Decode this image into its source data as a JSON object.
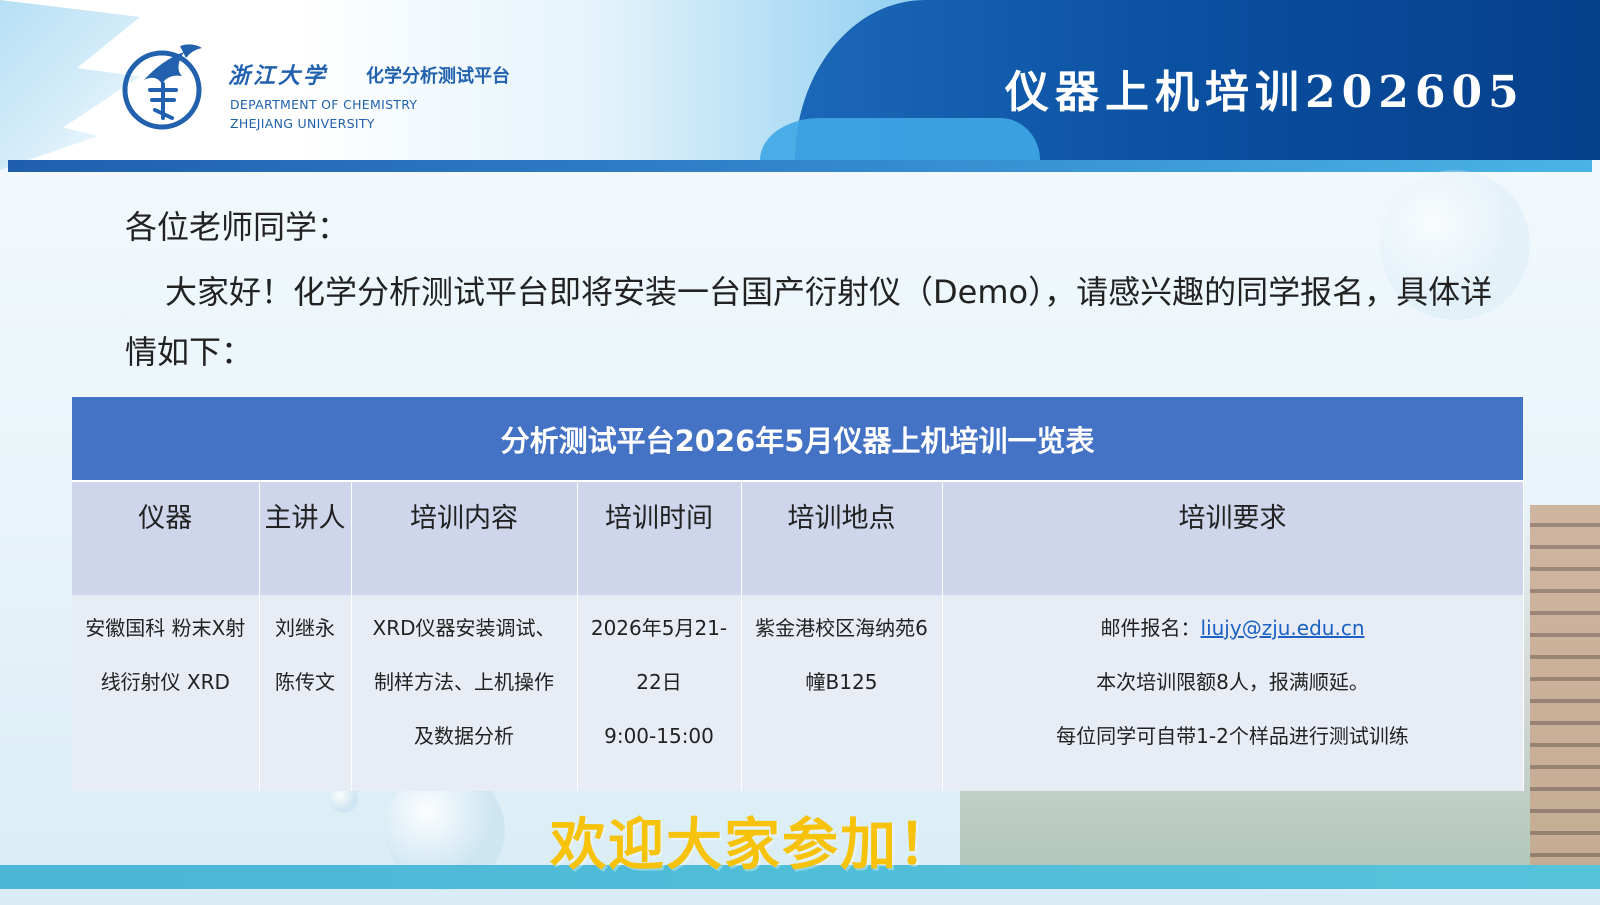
{
  "header": {
    "univ_cn": "浙江大学",
    "platform_cn": "化学分析测试平台",
    "dept_en": "DEPARTMENT OF CHEMISTRY",
    "univ_en": "ZHEJIANG UNIVERSITY",
    "banner_title": "仪器上机培训202605"
  },
  "body": {
    "greeting": "各位老师同学：",
    "intro": "大家好！化学分析测试平台即将安装一台国产衍射仪（Demo），请感兴趣的同学报名，具体详情如下："
  },
  "table": {
    "caption": "分析测试平台2026年5月仪器上机培训一览表",
    "headers": [
      "仪器",
      "主讲人",
      "培训内容",
      "培训时间",
      "培训地点",
      "培训要求"
    ],
    "row": {
      "instrument": [
        "安徽国科 粉末X射",
        "线衍射仪 XRD"
      ],
      "lecturers": [
        "刘继永",
        "陈传文"
      ],
      "content": [
        "XRD仪器安装调试、",
        "制样方法、上机操作",
        "及数据分析"
      ],
      "time": [
        "2026年5月21-",
        "22日",
        "9:00-15:00"
      ],
      "location": [
        "紫金港校区海纳苑6",
        "幢B125"
      ],
      "requirements": {
        "email_label": "邮件报名：",
        "email": "liujy@zju.edu.cn",
        "limit": "本次培训限额8人，报满顺延。",
        "samples": "每位同学可自带1-2个样品进行测试训练"
      }
    }
  },
  "footer": {
    "welcome": "欢迎大家参加！"
  },
  "colors": {
    "header_blue": "#0a4fa0",
    "table_caption": "#4472c4",
    "table_header": "#cfd6ec",
    "table_body": "#e8ecf5",
    "welcome_yellow": "#f6c20a",
    "link_blue": "#1b62c4"
  }
}
